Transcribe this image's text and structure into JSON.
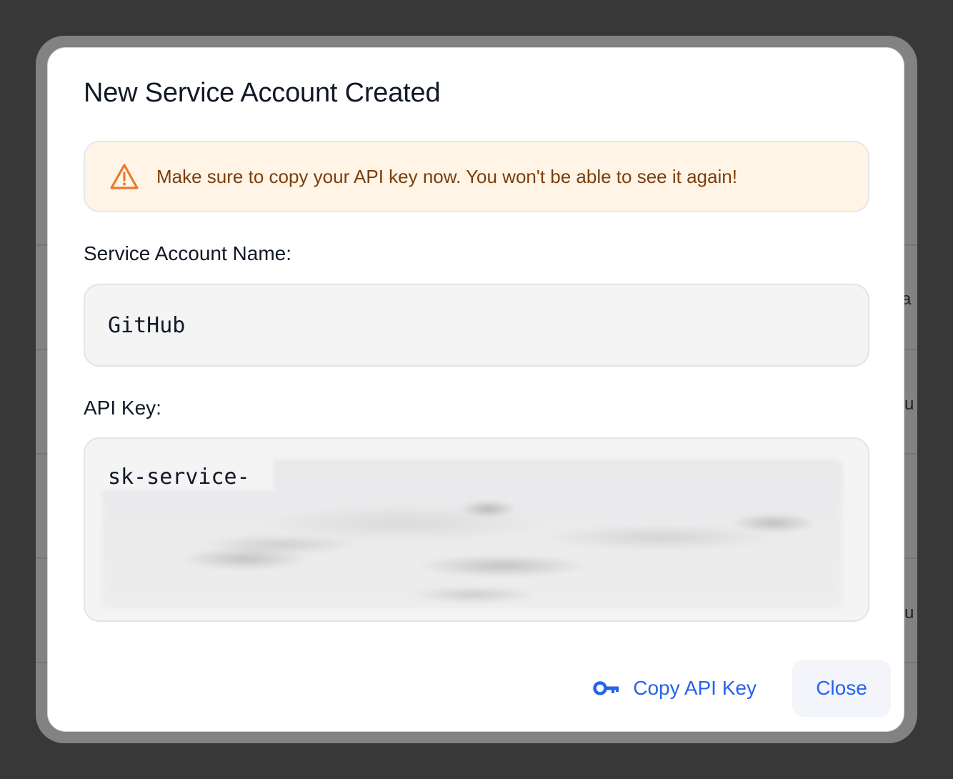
{
  "background": {
    "partial_texts": [
      "ra",
      "cu",
      "cu"
    ]
  },
  "dialog": {
    "title": "New Service Account Created",
    "warning": {
      "icon": "warning-triangle-icon",
      "text": "Make sure to copy your API key now. You won't be able to see it again!",
      "icon_color": "#ea7a2f"
    },
    "name_field": {
      "label": "Service Account Name:",
      "value": "GitHub"
    },
    "key_field": {
      "label": "API Key:",
      "value_prefix": "sk-service-"
    },
    "actions": {
      "copy_label": "Copy API Key",
      "copy_icon": "key-icon",
      "close_label": "Close"
    },
    "accent_color": "#2563eb"
  }
}
